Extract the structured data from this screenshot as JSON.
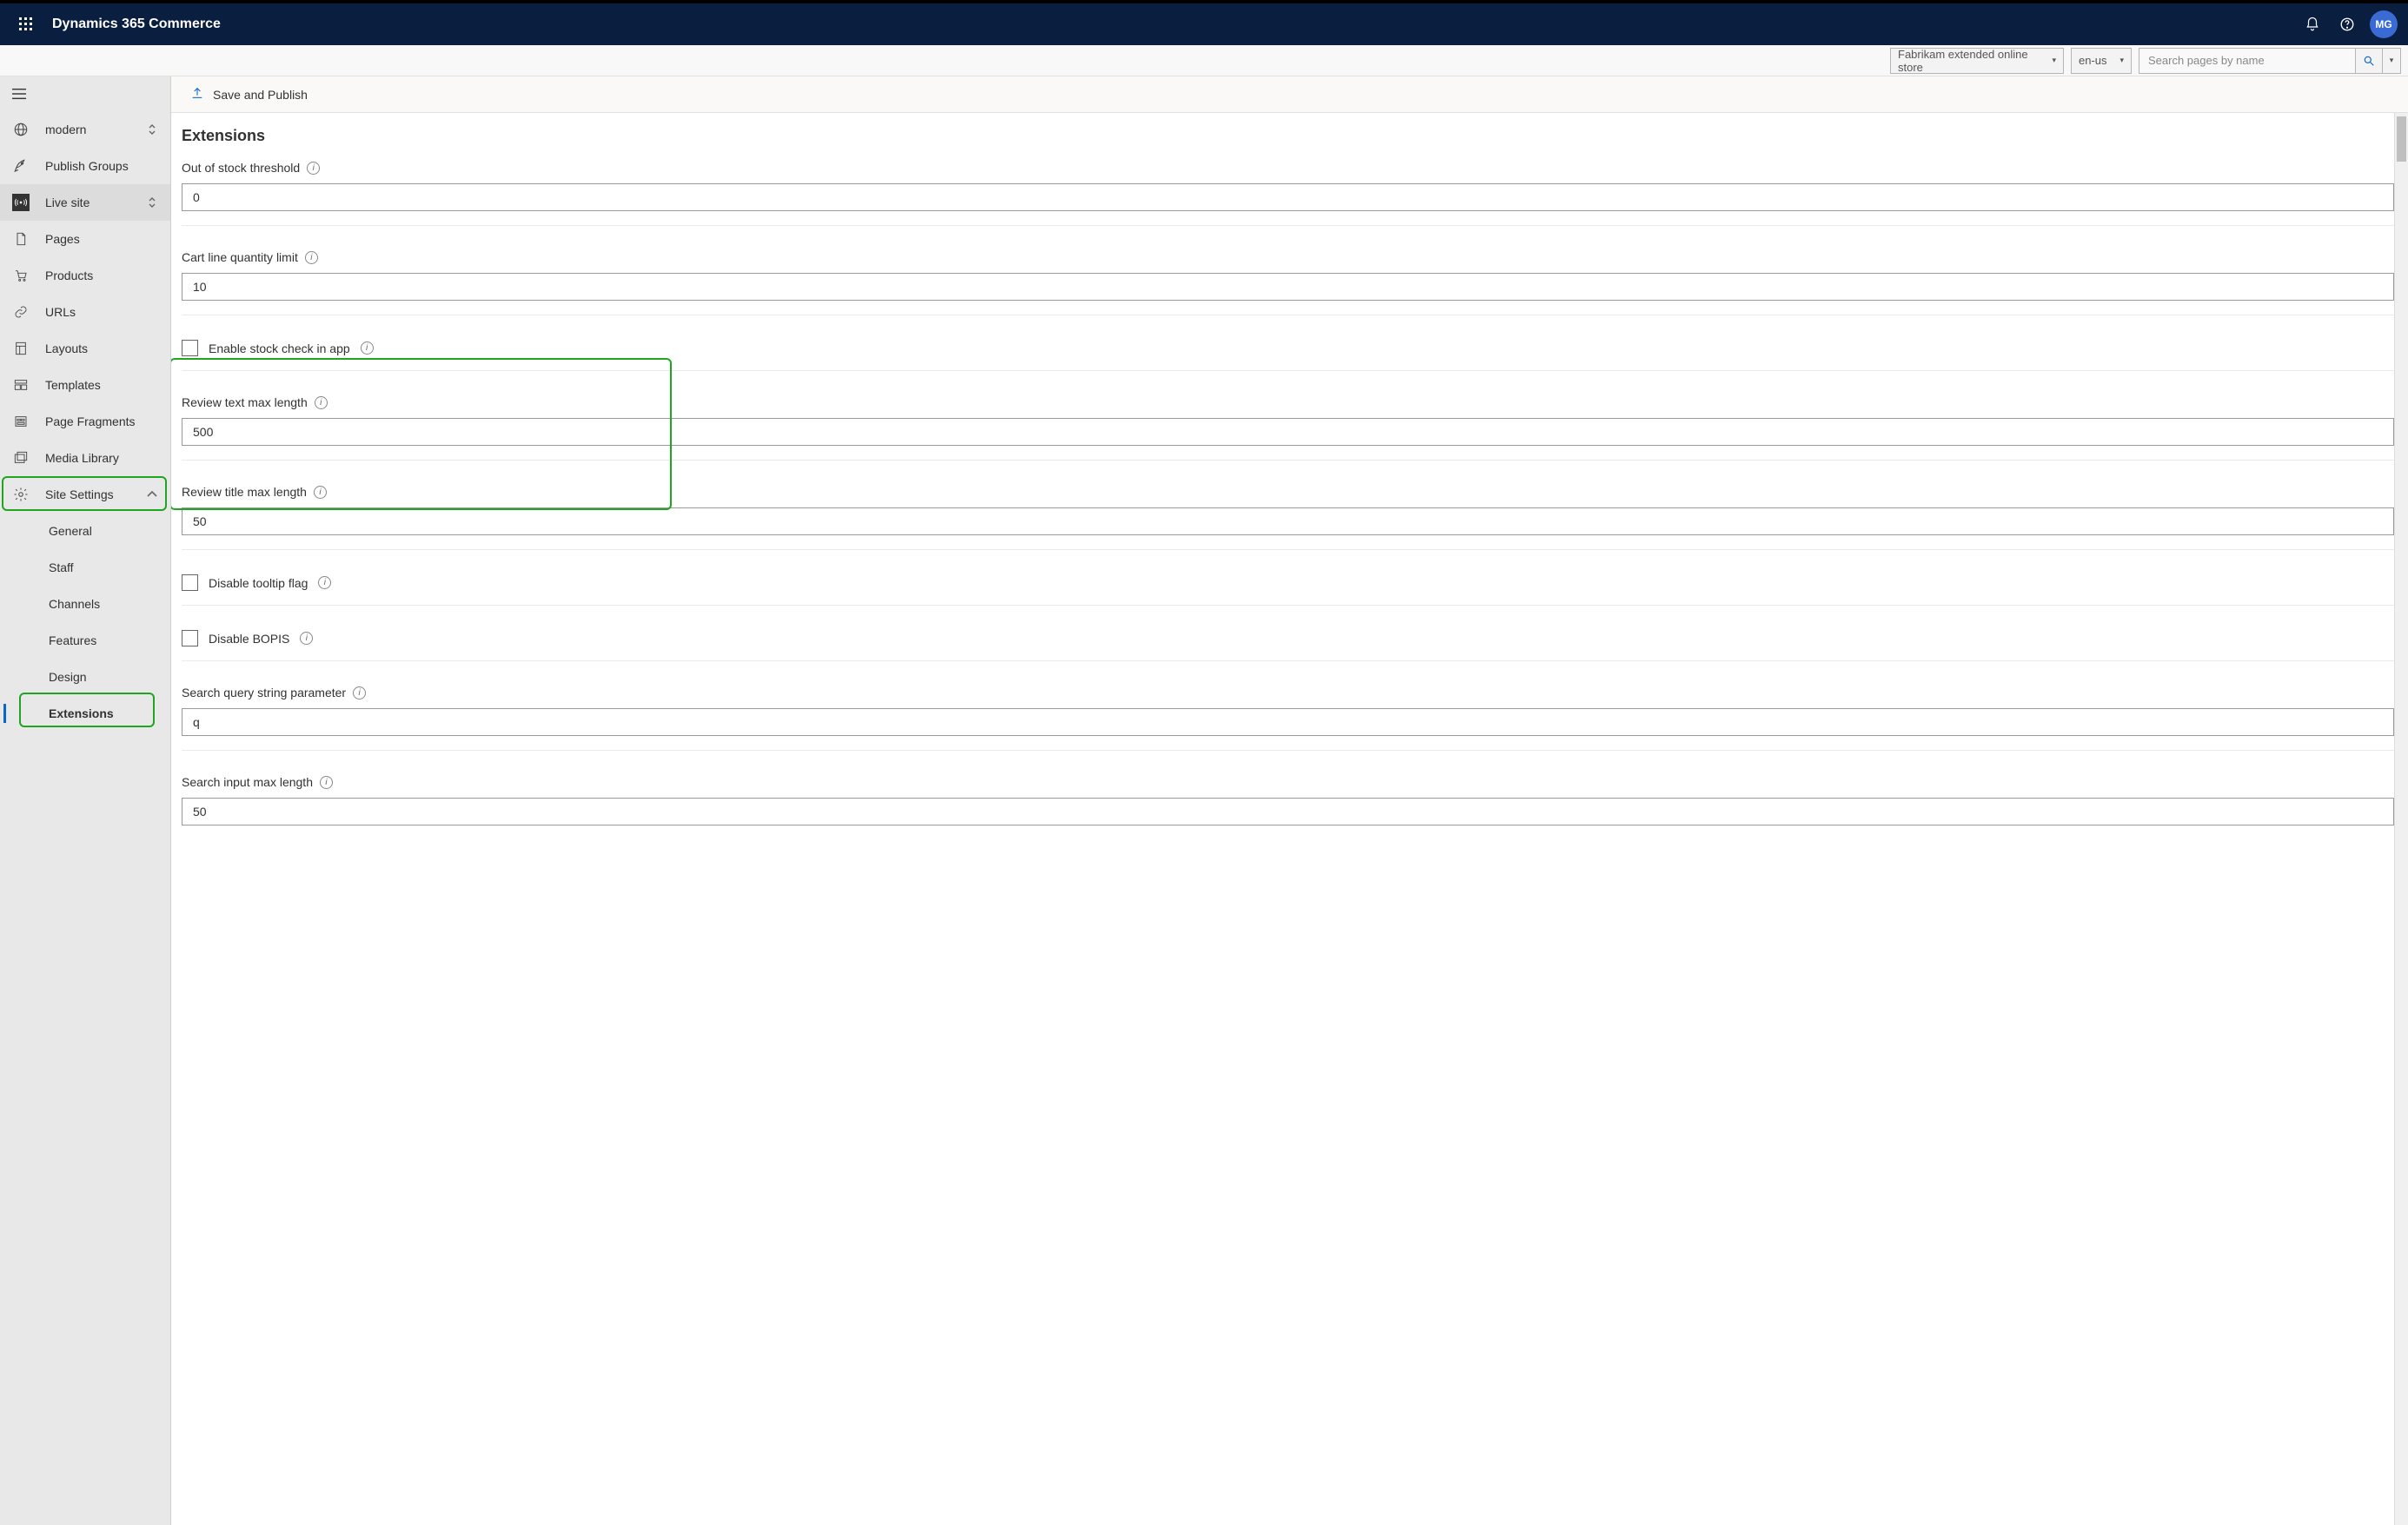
{
  "header": {
    "app_title": "Dynamics 365 Commerce",
    "avatar_initials": "MG"
  },
  "subheader": {
    "store_name": "Fabrikam extended online store",
    "locale": "en-us",
    "search_placeholder": "Search pages by name"
  },
  "sidebar": {
    "modern": "modern",
    "publish_groups": "Publish Groups",
    "live_site": "Live site",
    "pages": "Pages",
    "products": "Products",
    "urls": "URLs",
    "layouts": "Layouts",
    "templates": "Templates",
    "page_fragments": "Page Fragments",
    "media_library": "Media Library",
    "site_settings": "Site Settings",
    "sub": {
      "general": "General",
      "staff": "Staff",
      "channels": "Channels",
      "features": "Features",
      "design": "Design",
      "extensions": "Extensions"
    }
  },
  "toolbar": {
    "save_publish": "Save and Publish"
  },
  "page": {
    "title": "Extensions",
    "fields": {
      "out_of_stock_label": "Out of stock threshold",
      "out_of_stock_value": "0",
      "cart_line_label": "Cart line quantity limit",
      "cart_line_value": "10",
      "enable_stock_label": "Enable stock check in app",
      "review_text_label": "Review text max length",
      "review_text_value": "500",
      "review_title_label": "Review title max length",
      "review_title_value": "50",
      "disable_tooltip_label": "Disable tooltip flag",
      "disable_bopis_label": "Disable BOPIS",
      "search_query_label": "Search query string parameter",
      "search_query_value": "q",
      "search_input_max_label": "Search input max length",
      "search_input_max_value": "50"
    }
  }
}
